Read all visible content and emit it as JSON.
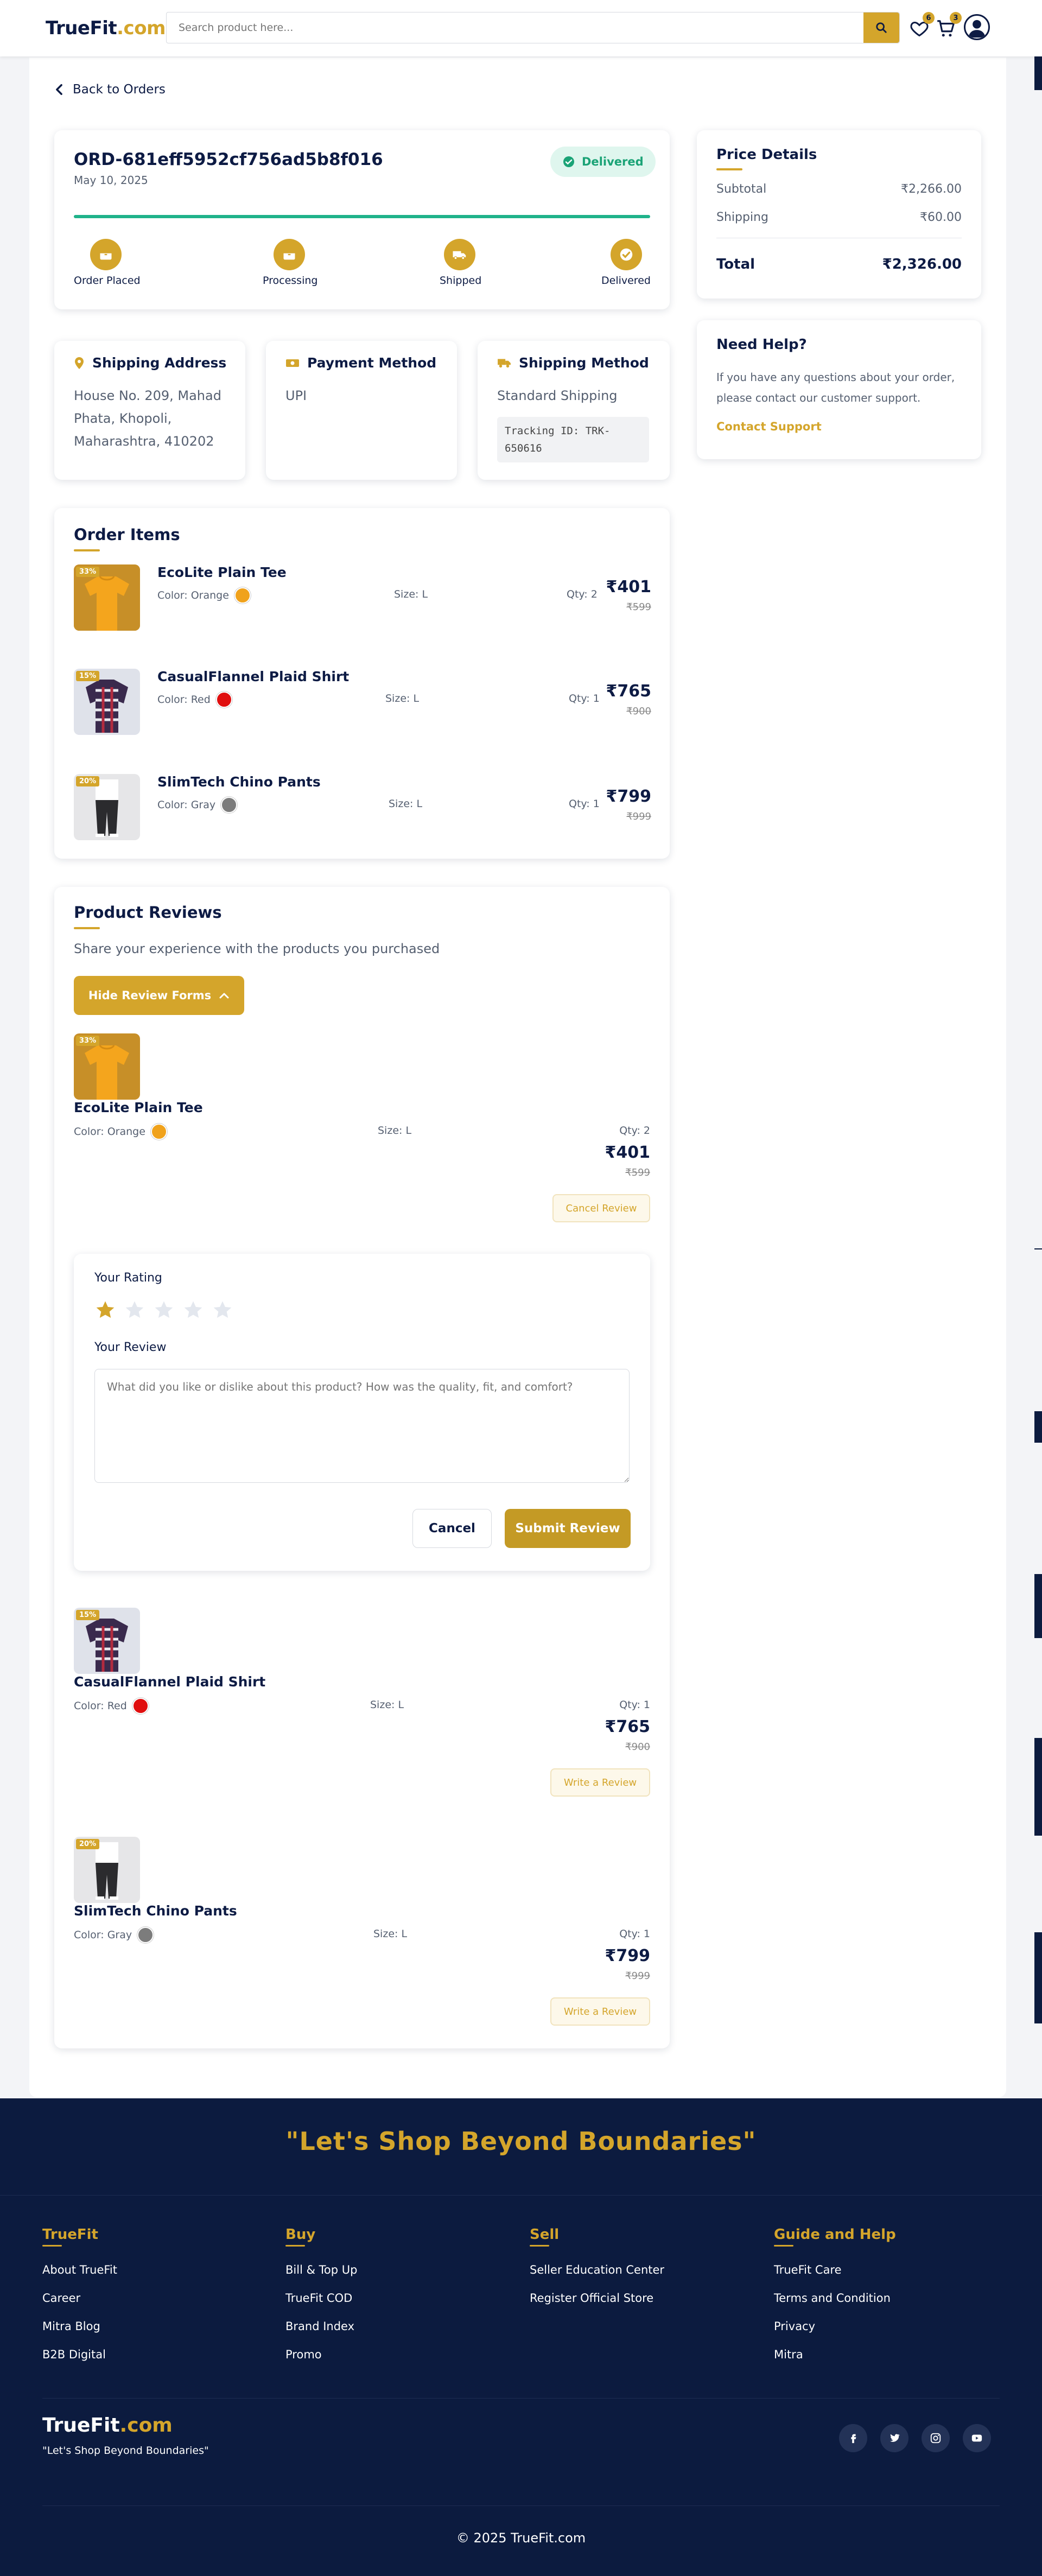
{
  "header": {
    "logo_main": "TrueFit",
    "logo_dot": ".com",
    "search_placeholder": "Search product here...",
    "wishlist_count": "6",
    "cart_count": "3"
  },
  "nav": {
    "back_label": "Back to Orders"
  },
  "order": {
    "id": "ORD-681eff5952cf756ad5b8f016",
    "date": "May 10, 2025",
    "status": "Delivered",
    "steps": [
      "Order Placed",
      "Processing",
      "Shipped",
      "Delivered"
    ]
  },
  "price_details": {
    "title": "Price Details",
    "subtotal_label": "Subtotal",
    "subtotal_value": "₹2,266.00",
    "shipping_label": "Shipping",
    "shipping_value": "₹60.00",
    "total_label": "Total",
    "total_value": "₹2,326.00"
  },
  "help": {
    "title": "Need Help?",
    "text_line1": "If you have any questions about your order,",
    "text_line2": "please contact our customer support.",
    "link": "Contact Support"
  },
  "shipping_address": {
    "title": "Shipping Address",
    "line1": "House No. 209, Mahad",
    "line2": "Phata, Khopoli,",
    "line3": "Maharashtra, 410202"
  },
  "payment": {
    "title": "Payment Method",
    "value": "UPI"
  },
  "shipping_method": {
    "title": "Shipping Method",
    "value": "Standard Shipping",
    "tracking_line1": "Tracking ID: TRK-",
    "tracking_line2": "650616"
  },
  "order_items": {
    "title": "Order Items",
    "items": [
      {
        "name": "EcoLite Plain Tee",
        "color": "Color: Orange",
        "swatch": "#f0a21c",
        "size": "Size: L",
        "qty": "Qty: 2",
        "price": "₹401",
        "old_price": "₹599",
        "discount": "33%"
      },
      {
        "name": "CasualFlannel Plaid Shirt",
        "color": "Color: Red",
        "swatch": "#e00f0f",
        "size": "Size: L",
        "qty": "Qty: 1",
        "price": "₹765",
        "old_price": "₹900",
        "discount": "15%"
      },
      {
        "name": "SlimTech Chino Pants",
        "color": "Color: Gray",
        "swatch": "#7c7c7c",
        "size": "Size: L",
        "qty": "Qty: 1",
        "price": "₹799",
        "old_price": "₹999",
        "discount": "20%"
      }
    ]
  },
  "reviews": {
    "title": "Product Reviews",
    "subtitle": "Share your experience with the products you purchased",
    "toggle_label": "Hide Review Forms",
    "cancel_review": "Cancel Review",
    "write_review": "Write a Review",
    "form": {
      "rating_label": "Your Rating",
      "rating": 1,
      "rating_max": 5,
      "review_label": "Your Review",
      "review_placeholder": "What did you like or dislike about this product? How was the quality, fit, and comfort?",
      "cancel": "Cancel",
      "submit": "Submit Review"
    }
  },
  "footer": {
    "slogan": "\"Let's Shop Beyond Boundaries\"",
    "columns": [
      {
        "title": "TrueFit",
        "links": [
          "About TrueFit",
          "Career",
          "Mitra Blog",
          "B2B Digital"
        ]
      },
      {
        "title": "Buy",
        "links": [
          "Bill & Top Up",
          "TrueFit COD",
          "Brand Index",
          "Promo"
        ]
      },
      {
        "title": "Sell",
        "links": [
          "Seller Education Center",
          "Register Official Store"
        ]
      },
      {
        "title": "Guide and Help",
        "links": [
          "TrueFit Care",
          "Terms and Condition",
          "Privacy",
          "Mitra"
        ]
      }
    ],
    "brand_main": "TrueFit",
    "brand_dot": ".com",
    "brand_tagline": "\"Let's Shop Beyond Boundaries\"",
    "social_icons": [
      "facebook-icon",
      "twitter-icon",
      "instagram-icon",
      "youtube-icon"
    ],
    "copyright": "© 2025 TrueFit.com"
  },
  "colors": {
    "accent": "#d4a52b",
    "navy": "#0c1b3f",
    "success": "#1aa376"
  }
}
